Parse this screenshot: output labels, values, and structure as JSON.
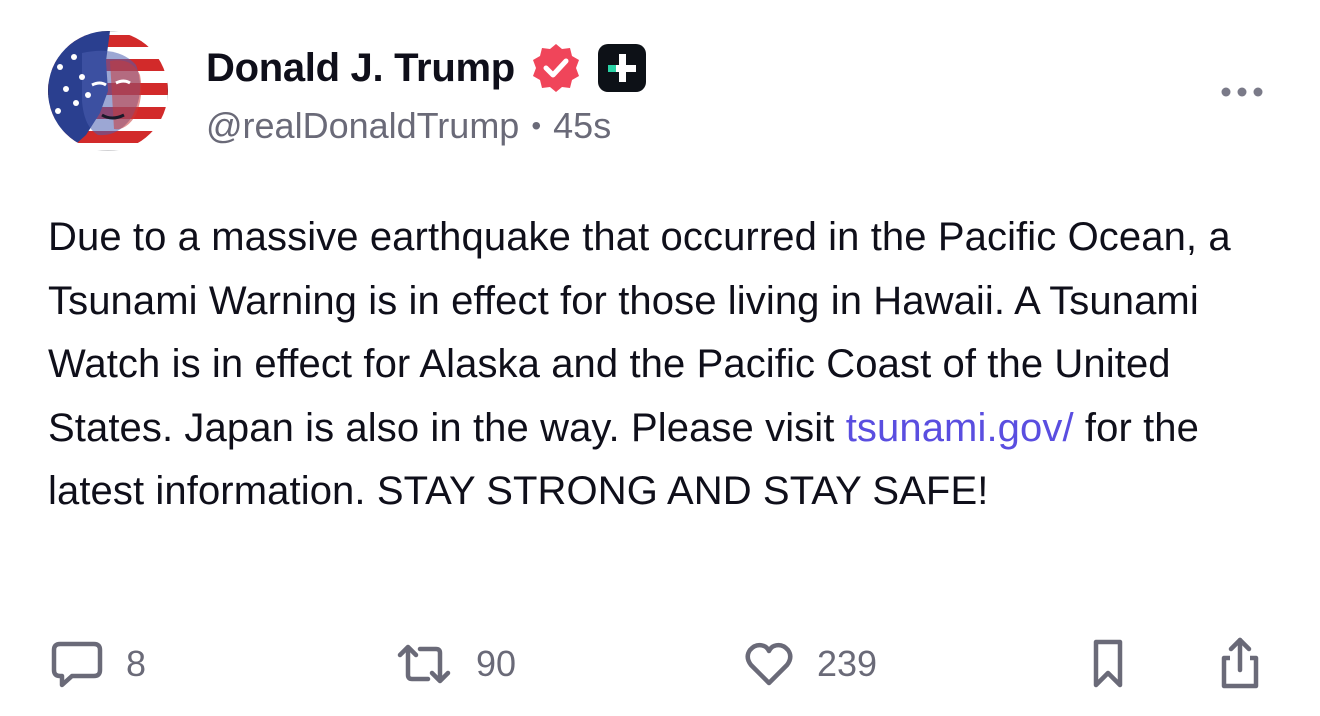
{
  "author": {
    "display_name": "Donald J. Trump",
    "handle": "@realDonaldTrump",
    "separator": "•",
    "timestamp": "45s",
    "avatar_icon": "flag-face-avatar",
    "verified_icon": "verified-badge-icon",
    "verified_color": "#f0455a",
    "plus_icon": "plus-badge-icon",
    "plus_badge_color": "#0d1117",
    "plus_badge_accent": "#2ad3a6"
  },
  "post": {
    "text_before_link": "Due to a massive earthquake that occurred in the Pacific Ocean, a Tsunami Warning is in effect for those living in Hawaii. A Tsunami Watch is in effect for Alaska and the Pacific Coast of the United States. Japan is also in the way. Please visit ",
    "link_text": "tsunami.gov/",
    "text_after_link": " for the latest information. STAY STRONG AND STAY SAFE!",
    "link_color": "#5a4ee0"
  },
  "actions": {
    "reply": {
      "icon": "comment-icon",
      "count": "8"
    },
    "repost": {
      "icon": "repost-icon",
      "count": "90"
    },
    "like": {
      "icon": "heart-icon",
      "count": "239"
    },
    "bookmark": {
      "icon": "bookmark-icon"
    },
    "share": {
      "icon": "share-icon"
    }
  },
  "more_menu": {
    "icon": "more-dots-icon"
  }
}
